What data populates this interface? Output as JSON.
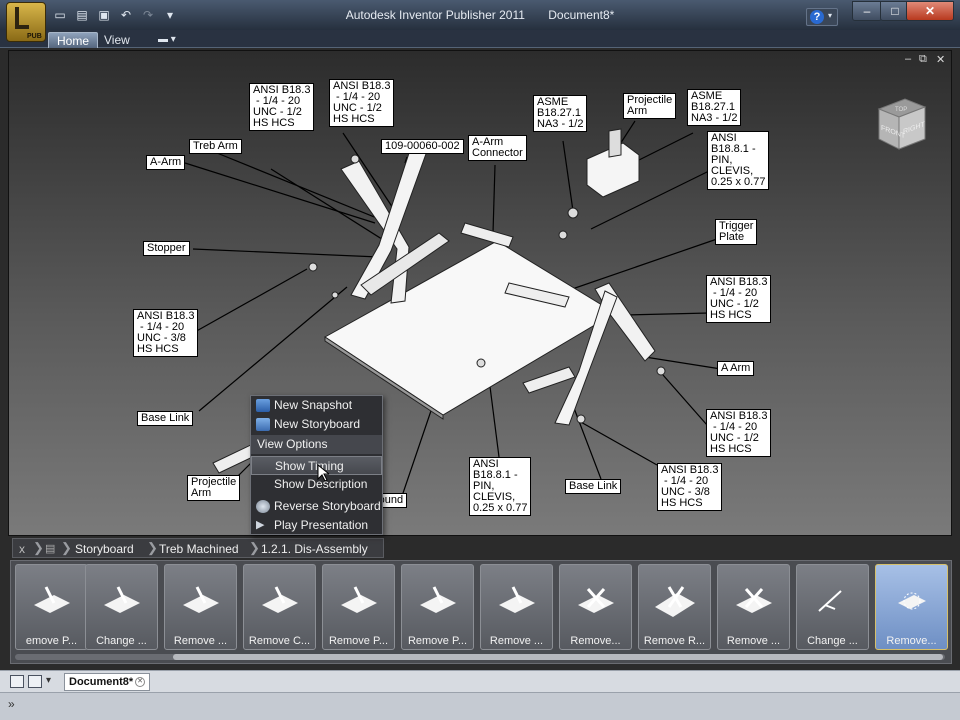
{
  "app": {
    "badge": "PUB",
    "title": "Autodesk Inventor Publisher 2011",
    "document": "Document8*"
  },
  "qat_icons": [
    "new-icon",
    "open-icon",
    "save-icon",
    "undo-icon",
    "redo-icon",
    "qat-dropdown-icon"
  ],
  "window_controls": {
    "minimize": "–",
    "maximize": "□",
    "close": "✕"
  },
  "ribbon": {
    "tabs": [
      "Home",
      "View"
    ]
  },
  "viewport": {
    "controls": [
      "–",
      "⧉",
      "✕"
    ],
    "viewcube": {
      "front": "FRONT",
      "right": "RIGHT",
      "top": "TOP"
    }
  },
  "callouts": [
    "ANSI B18.3\n - 1/4 - 20\nUNC - 1/2\nHS HCS",
    "ANSI B18.3\n - 1/4 - 20\nUNC - 1/2\nHS HCS",
    "Treb Arm",
    "A-Arm",
    "109-00060-002",
    "A-Arm\nConnector",
    "ASME\nB18.27.1\nNA3 - 1/2",
    "Projectile\nArm",
    "ASME\nB18.27.1\nNA3 - 1/2",
    "ANSI\nB18.8.1 -\nPIN,\nCLEVIS,\n0.25 x 0.77",
    "Stopper",
    "Trigger\nPlate",
    "ANSI B18.3\n - 1/4 - 20\nUNC - 1/2\nHS HCS",
    "ANSI B18.3\n - 1/4 - 20\nUNC - 3/8\nHS HCS",
    "A Arm",
    "Base Link",
    "ANSI B18.3\n - 1/4 - 20\nUNC - 1/2\nHS HCS",
    "Projectile\nArm",
    "ANSI\nB18.8.1 -\nPIN,\nCLEVIS,\n0.25 x 0.77",
    "Base Link",
    "ANSI B18.3\n - 1/4 - 20\nUNC - 3/8\nHS HCS",
    "round"
  ],
  "context_menu": {
    "items": [
      {
        "label": "New Snapshot",
        "icon": "camera-icon"
      },
      {
        "label": "New Storyboard",
        "icon": "storyboard-icon"
      },
      {
        "header": "View Options"
      },
      {
        "label": "Show Timing",
        "highlighted": true
      },
      {
        "label": "Show Description"
      },
      {
        "label": "Reverse Storyboard",
        "icon": "reverse-icon"
      },
      {
        "label": "Play Presentation",
        "icon": "play-icon"
      }
    ]
  },
  "breadcrumb": {
    "close": "x",
    "items": [
      "Storyboard",
      "Treb Machined",
      "1.2.1. Dis-Assembly"
    ]
  },
  "storyboard": {
    "thumbnails": [
      "emove P...",
      "Change ...",
      "Remove ...",
      "Remove C...",
      "Remove P...",
      "Remove P...",
      "Remove ...",
      "Remove...",
      "Remove R...",
      "Remove ...",
      "Change ...",
      "Remove..."
    ],
    "selected_index": 11
  },
  "doc_tabs": [
    "Document8*"
  ],
  "status": {
    "arrow": "»"
  }
}
